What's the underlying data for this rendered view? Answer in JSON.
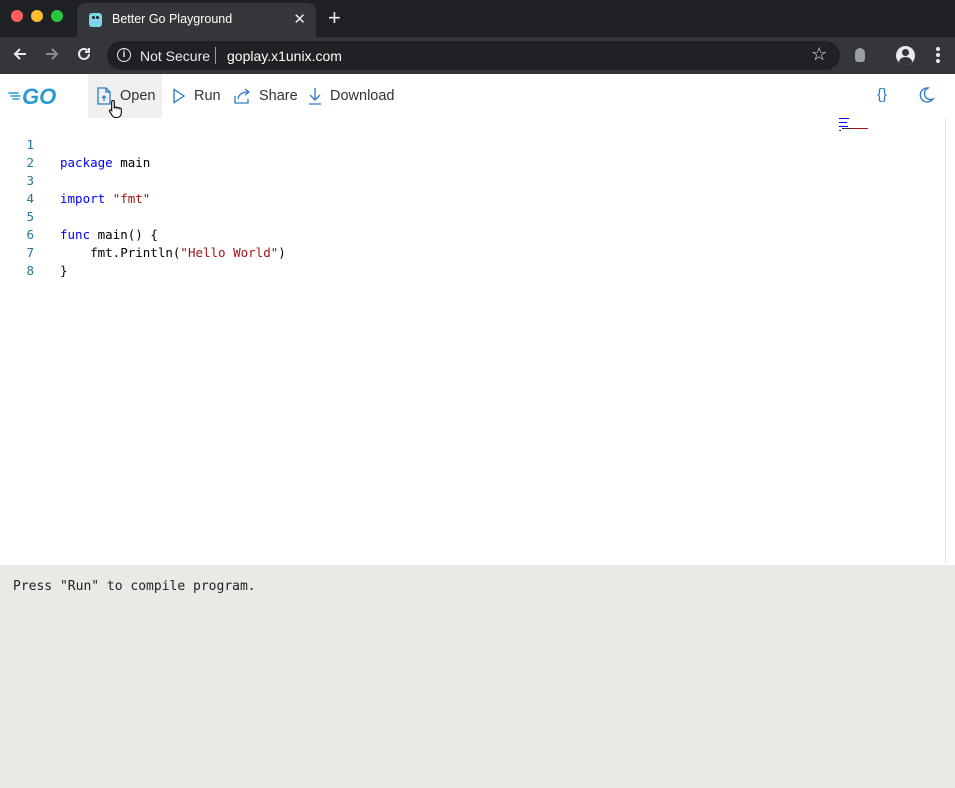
{
  "browser": {
    "tab_title": "Better Go Playground",
    "tab_close": "✕",
    "new_tab": "+",
    "security_label": "Not Secure",
    "url": "goplay.x1unix.com"
  },
  "toolbar": {
    "open_label": "Open",
    "run_label": "Run",
    "share_label": "Share",
    "download_label": "Download",
    "format_label": "{}"
  },
  "editor": {
    "lines": [
      {
        "num": "1",
        "kw": "package",
        "rest": " main",
        "str": ""
      },
      {
        "num": "2",
        "kw": "",
        "rest": "",
        "str": ""
      },
      {
        "num": "3",
        "kw": "import",
        "rest": " ",
        "str": "\"fmt\""
      },
      {
        "num": "4",
        "kw": "",
        "rest": "",
        "str": ""
      },
      {
        "num": "5",
        "kw": "func",
        "rest": " main() {",
        "str": ""
      },
      {
        "num": "6",
        "kw": "",
        "rest": "    fmt.Println(",
        "str": "\"Hello World\"",
        "tail": ")"
      },
      {
        "num": "7",
        "kw": "",
        "rest": "}",
        "str": ""
      },
      {
        "num": "8",
        "kw": "",
        "rest": "",
        "str": ""
      }
    ]
  },
  "output": {
    "message": "Press \"Run\" to compile program."
  },
  "colors": {
    "accent": "#2a7ac8",
    "keyword": "#0000ff",
    "string": "#a31515",
    "line_number": "#237893",
    "output_bg": "#ebe9e6"
  }
}
